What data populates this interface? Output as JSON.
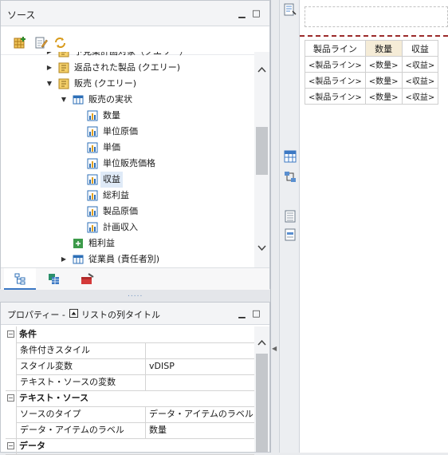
{
  "source_panel": {
    "title": "ソース",
    "min_glyph": "▁",
    "max_glyph": "□",
    "toolbar_icons": [
      "grid-plus-icon",
      "edit-icon",
      "refresh-icon"
    ],
    "tree": [
      {
        "label": "予見業計画対象（クエリー）",
        "depth": 1,
        "twisty": "▶",
        "icon": "query-icon"
      },
      {
        "label": "返品された製品 (クエリー)",
        "depth": 1,
        "twisty": "▶",
        "icon": "query-icon"
      },
      {
        "label": "販売 (クエリー)",
        "depth": 1,
        "twisty": "▼",
        "icon": "query-icon"
      },
      {
        "label": "販売の実状",
        "depth": 2,
        "twisty": "▼",
        "icon": "fact-table-icon"
      },
      {
        "label": "数量",
        "depth": 3,
        "twisty": "",
        "icon": "measure-icon"
      },
      {
        "label": "単位原価",
        "depth": 3,
        "twisty": "",
        "icon": "measure-icon"
      },
      {
        "label": "単価",
        "depth": 3,
        "twisty": "",
        "icon": "measure-icon"
      },
      {
        "label": "単位販売価格",
        "depth": 3,
        "twisty": "",
        "icon": "measure-icon"
      },
      {
        "label": "収益",
        "depth": 3,
        "twisty": "",
        "icon": "measure-icon",
        "selected": true
      },
      {
        "label": "総利益",
        "depth": 3,
        "twisty": "",
        "icon": "measure-icon"
      },
      {
        "label": "製品原価",
        "depth": 3,
        "twisty": "",
        "icon": "measure-icon"
      },
      {
        "label": "計画収入",
        "depth": 3,
        "twisty": "",
        "icon": "measure-icon"
      },
      {
        "label": "粗利益",
        "depth": 2,
        "twisty": "",
        "icon": "calc-icon"
      },
      {
        "label": "従業員 (責任者別)",
        "depth": 2,
        "twisty": "▶",
        "icon": "fact-table-icon"
      }
    ],
    "tabs": [
      "source-tree-tab-icon",
      "data-items-tab-icon",
      "toolbox-tab-icon"
    ],
    "sash_dots": "....."
  },
  "properties_panel": {
    "title": "プロパティー - ",
    "subtitle": "リストの列タイトル",
    "min_glyph": "▁",
    "max_glyph": "□",
    "rows": [
      {
        "kind": "cat",
        "name": "条件",
        "value": "",
        "exp": "⊟"
      },
      {
        "kind": "sub",
        "name": "条件付きスタイル",
        "value": ""
      },
      {
        "kind": "sub",
        "name": "スタイル変数",
        "value": "vDISP"
      },
      {
        "kind": "sub",
        "name": "テキスト・ソースの変数",
        "value": ""
      },
      {
        "kind": "cat",
        "name": "テキスト・ソース",
        "value": "",
        "exp": "⊟"
      },
      {
        "kind": "sub",
        "name": "ソースのタイプ",
        "value": "データ・アイテムのラベル"
      },
      {
        "kind": "sub",
        "name": "データ・アイテムのラベル",
        "value": "数量"
      },
      {
        "kind": "cat",
        "name": "データ",
        "value": "",
        "exp": "⊟"
      }
    ]
  },
  "collapse_arrow": "◀",
  "list_report": {
    "headers": [
      "製品ライン",
      "数量",
      "収益"
    ],
    "rows": [
      [
        "<製品ライン>",
        "<数量>",
        "<収益>"
      ],
      [
        "<製品ライン>",
        "<数量>",
        "<収益>"
      ],
      [
        "<製品ライン>",
        "<数量>",
        "<収益>"
      ]
    ]
  },
  "colors": {
    "selection": "#dfeaf7",
    "header_highlight": "#f5ecd7",
    "page_break": "#9b2a2a"
  }
}
